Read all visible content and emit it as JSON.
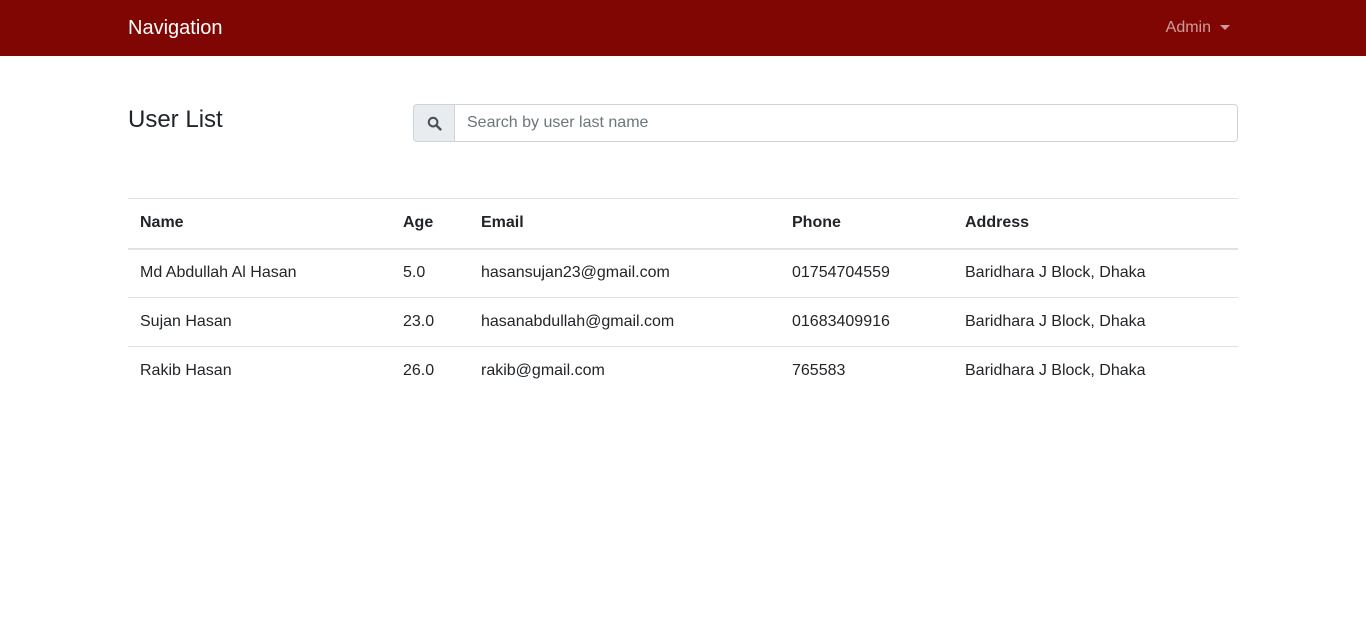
{
  "navbar": {
    "brand": "Navigation",
    "user_menu": "Admin"
  },
  "page": {
    "title": "User List"
  },
  "search": {
    "icon": "search-icon",
    "placeholder": "Search by user last name",
    "value": ""
  },
  "table": {
    "headers": [
      "Name",
      "Age",
      "Email",
      "Phone",
      "Address"
    ],
    "rows": [
      [
        "Md Abdullah Al Hasan",
        "5.0",
        "hasansujan23@gmail.com",
        "01754704559",
        "Baridhara J Block, Dhaka"
      ],
      [
        "Sujan Hasan",
        "23.0",
        "hasanabdullah@gmail.com",
        "01683409916",
        "Baridhara J Block, Dhaka"
      ],
      [
        "Rakib Hasan",
        "26.0",
        "rakib@gmail.com",
        "765583",
        "Baridhara J Block, Dhaka"
      ]
    ]
  },
  "colors": {
    "navbar_bg": "#800603",
    "text": "#212529",
    "border": "#dee2e6"
  }
}
